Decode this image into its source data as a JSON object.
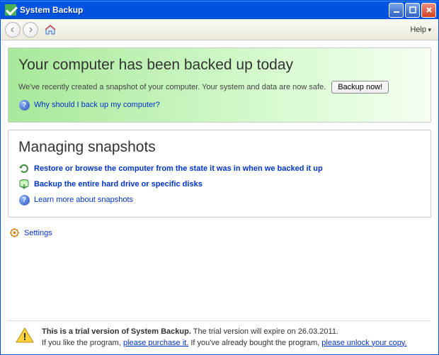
{
  "window": {
    "title": "System Backup"
  },
  "toolbar": {
    "help": "Help"
  },
  "status_panel": {
    "title": "Your computer has been backed up today",
    "description": "We've recently created a snapshot of your computer. Your system and data are now safe.",
    "backup_button": "Backup now!",
    "why_link": "Why should I back up my computer?"
  },
  "snapshots_panel": {
    "title": "Managing snapshots",
    "restore_link": "Restore or browse the computer from the state it was in when we backed it up",
    "backup_link": "Backup the entire hard drive or specific disks",
    "learn_link": "Learn more about snapshots"
  },
  "settings": {
    "label": "Settings"
  },
  "trial": {
    "bold_prefix": "This is a trial version of System Backup.",
    "expire_text": " The trial version will expire on 26.03.2011.",
    "line2_prefix": "If you like the program, ",
    "purchase_link": "please purchase it.",
    "line2_mid": " If you've already bought the program, ",
    "unlock_link": "please unlock your copy."
  }
}
